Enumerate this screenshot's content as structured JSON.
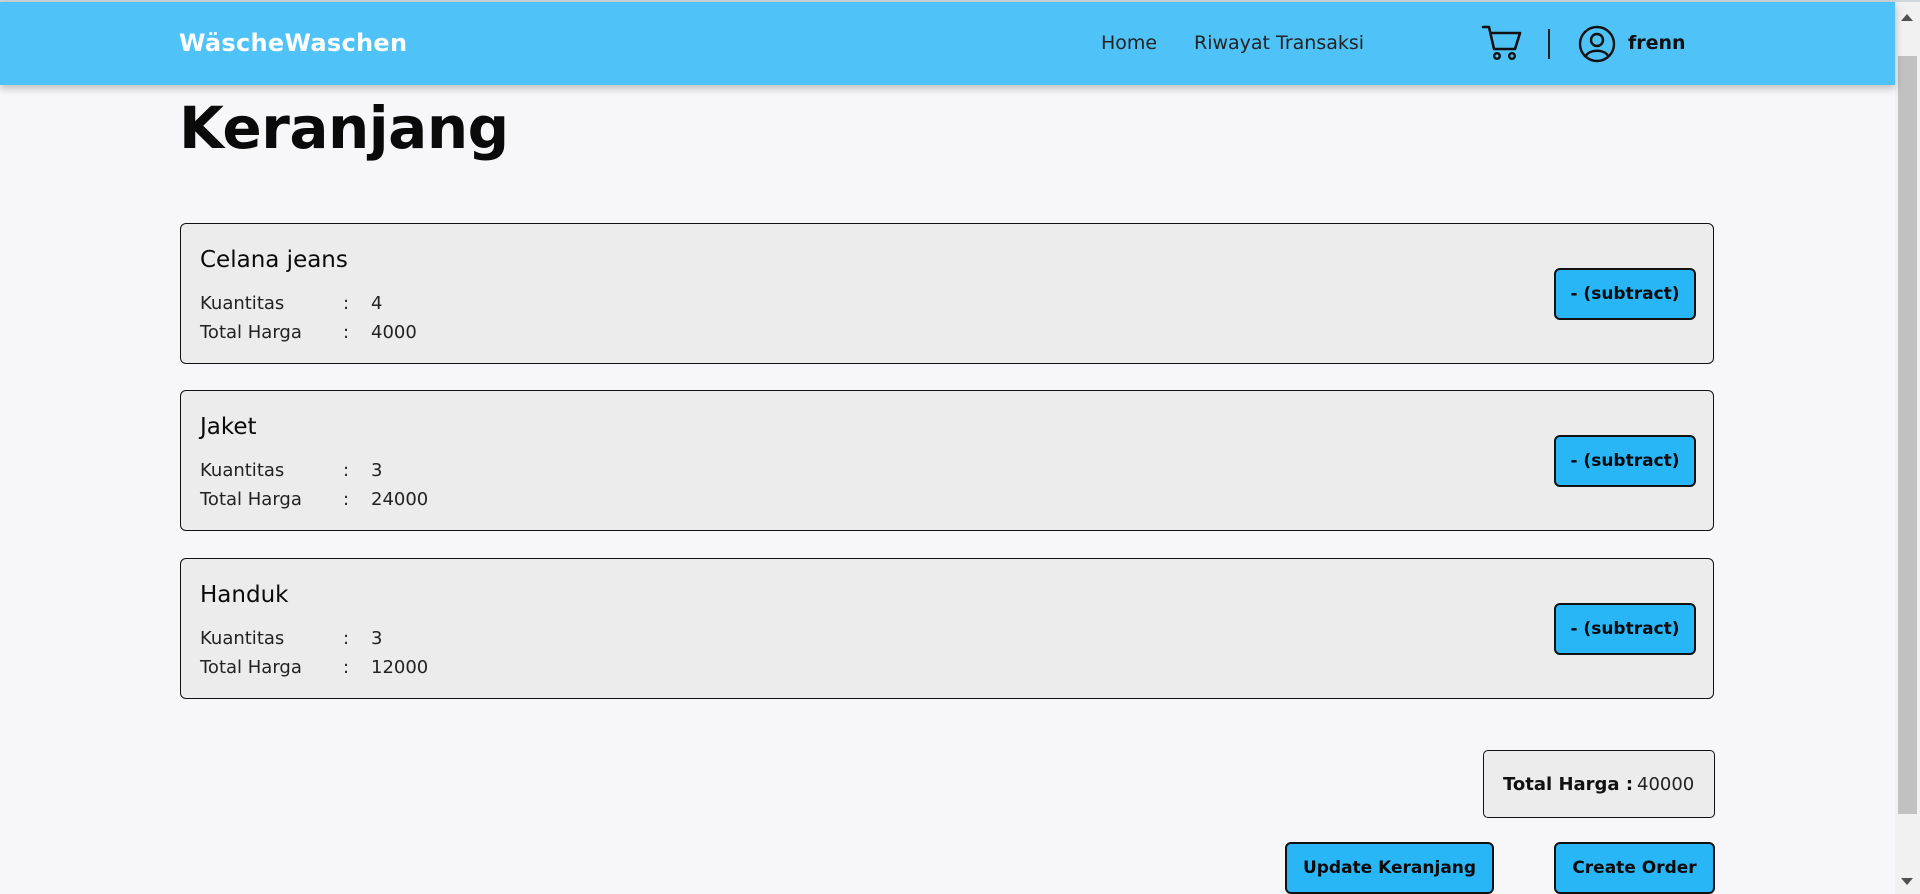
{
  "header": {
    "brand": "WäscheWaschen",
    "nav": {
      "home": "Home",
      "history": "Riwayat Transaksi"
    },
    "username": "frenn",
    "icons": {
      "cart": "cart-icon",
      "user": "user-icon"
    },
    "color": "#4fc3f7"
  },
  "page": {
    "title": "Keranjang"
  },
  "cart": {
    "items": [
      {
        "name": "Celana jeans",
        "qty_label": "Kuantitas",
        "qty": "4",
        "price_label": "Total Harga",
        "price": "4000",
        "button": "- (subtract)"
      },
      {
        "name": "Jaket",
        "qty_label": "Kuantitas",
        "qty": "3",
        "price_label": "Total Harga",
        "price": "24000",
        "button": "- (subtract)"
      },
      {
        "name": "Handuk",
        "qty_label": "Kuantitas",
        "qty": "3",
        "price_label": "Total Harga",
        "price": "12000",
        "button": "- (subtract)"
      }
    ],
    "separator": ":",
    "total_label": "Total Harga :",
    "total_value": "40000",
    "update_button": "Update Keranjang",
    "order_button": "Create Order"
  },
  "colors": {
    "accent": "#29b6f6",
    "card": "#ececec",
    "background": "#f7f7f9"
  }
}
